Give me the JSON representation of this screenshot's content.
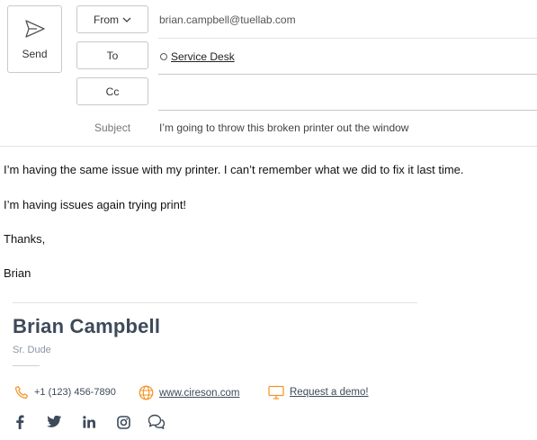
{
  "header": {
    "send_label": "Send",
    "from_label": "From",
    "from_value": "brian.campbell@tuellab.com",
    "to_label": "To",
    "to_recipient": "Service Desk",
    "cc_label": "Cc",
    "subject_label": "Subject",
    "subject_value": "I’m going to throw this broken printer out the window"
  },
  "body": {
    "line1": "I’m having the same issue with my printer.  I can’t remember what we did to fix it last time.",
    "line2": "I’m having issues again trying print!",
    "line3": "Thanks,",
    "line4": "Brian"
  },
  "signature": {
    "name": "Brian Campbell",
    "title": "Sr. Dude",
    "phone": "+1 (123) 456-7890",
    "website": "www.cireson.com",
    "demo_link": "Request a demo!",
    "accent_color": "#f39323"
  }
}
